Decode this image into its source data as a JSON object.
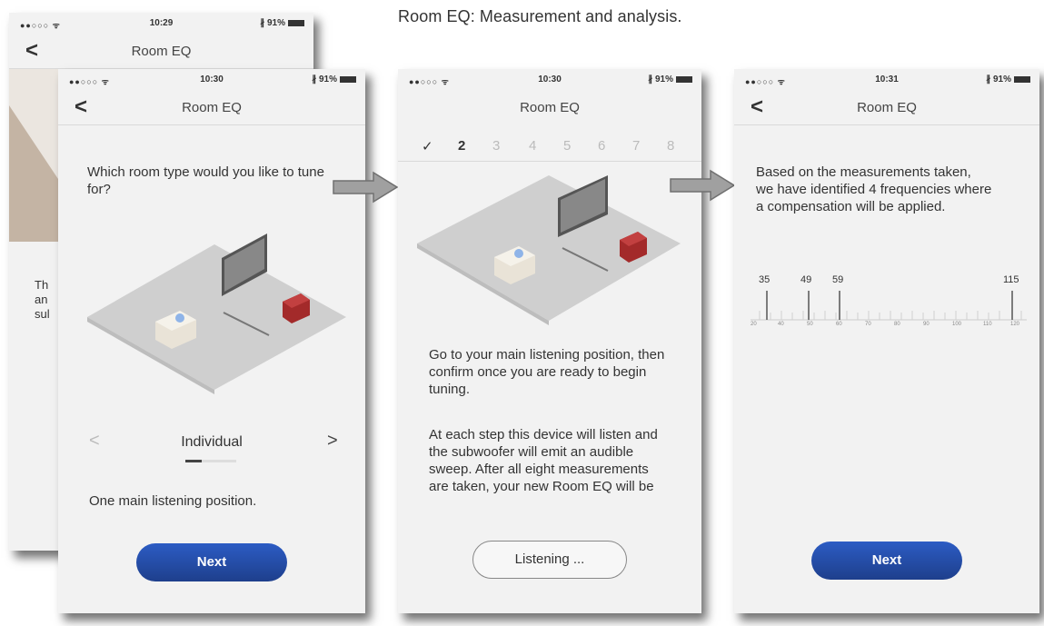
{
  "caption": "Room EQ: Measurement and analysis.",
  "back_phone": {
    "status": {
      "signal": "●●○○○ ᯤ",
      "time": "10:29",
      "battery": "∦ 91%"
    },
    "nav": {
      "back": "<",
      "title": "Room EQ"
    },
    "text_lines": [
      "Th",
      "an",
      "sul"
    ]
  },
  "screen1": {
    "status": {
      "signal": "●●○○○ ᯤ",
      "time": "10:30",
      "battery": "∦ 91%"
    },
    "nav": {
      "back": "<",
      "title": "Room EQ"
    },
    "question": "Which room type would you like to tune for?",
    "selector": {
      "prev": "<",
      "label": "Individual",
      "next": ">"
    },
    "description": "One main listening position.",
    "next_label": "Next"
  },
  "screen2": {
    "status": {
      "signal": "●●○○○ ᯤ",
      "time": "10:30",
      "battery": "∦ 91%"
    },
    "nav": {
      "title": "Room EQ"
    },
    "steps": [
      "✓",
      "2",
      "3",
      "4",
      "5",
      "6",
      "7",
      "8"
    ],
    "instruction": "Go to your main listening position, then confirm once you are ready to begin tuning.",
    "detail": "At each step this device will listen and the subwoofer will emit an audible sweep. After all eight measurements are taken, your new Room EQ will be",
    "listening_label": "Listening ..."
  },
  "screen3": {
    "status": {
      "signal": "●●○○○ ᯤ",
      "time": "10:31",
      "battery": "∦ 91%"
    },
    "nav": {
      "back": "<",
      "title": "Room EQ"
    },
    "summary": "Based on the measurements taken, we have identified 4 frequencies where a compensation will be applied.",
    "frequencies": [
      "35",
      "49",
      "59",
      "115"
    ],
    "scale_ticks": [
      "20",
      "40",
      "50",
      "60",
      "70",
      "80",
      "90",
      "100",
      "110",
      "120"
    ],
    "next_label": "Next"
  }
}
